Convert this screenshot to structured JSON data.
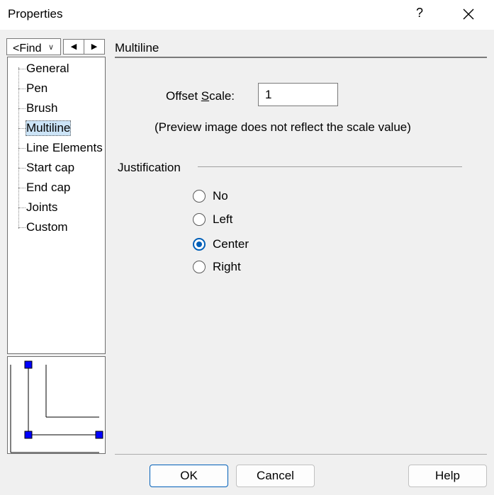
{
  "window": {
    "title": "Properties",
    "help_glyph": "?"
  },
  "find": {
    "value": "<Find"
  },
  "tree": {
    "items": [
      {
        "label": "General"
      },
      {
        "label": "Pen"
      },
      {
        "label": "Brush"
      },
      {
        "label": "Multiline",
        "selected": true
      },
      {
        "label": "Line Elements"
      },
      {
        "label": "Start cap"
      },
      {
        "label": "End cap"
      },
      {
        "label": "Joints"
      },
      {
        "label": "Custom"
      }
    ]
  },
  "panel": {
    "section_title": "Multiline",
    "offset_scale": {
      "label_pre": "Offset ",
      "label_mnemonic": "S",
      "label_post": "cale:",
      "value": "1"
    },
    "note": "(Preview image does not reflect the scale value)",
    "justification": {
      "label": "Justification",
      "options": [
        {
          "label": "No",
          "checked": false
        },
        {
          "label": "Left",
          "checked": false
        },
        {
          "label": "Center",
          "checked": true
        },
        {
          "label": "Right",
          "checked": false
        }
      ]
    }
  },
  "buttons": {
    "ok": "OK",
    "cancel": "Cancel",
    "help": "Help"
  },
  "colors": {
    "accent": "#005fb8",
    "selection": "#cce4f7",
    "handle": "#0000ff"
  }
}
